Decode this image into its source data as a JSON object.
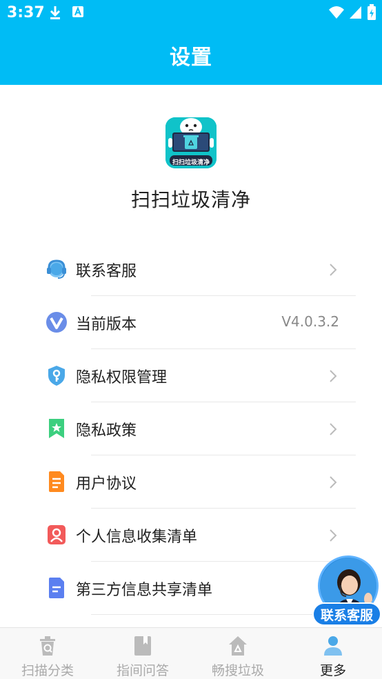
{
  "status_bar": {
    "time": "3:37"
  },
  "header": {
    "title": "设置"
  },
  "app": {
    "name": "扫扫垃圾清净",
    "logo_text": "扫扫垃圾清净"
  },
  "menu": {
    "items": [
      {
        "label": "联系客服",
        "icon": "headset-icon",
        "has_arrow": true
      },
      {
        "label": "当前版本",
        "icon": "version-icon",
        "value": "V4.0.3.2"
      },
      {
        "label": "隐私权限管理",
        "icon": "shield-key-icon",
        "has_arrow": true
      },
      {
        "label": "隐私政策",
        "icon": "bookmark-star-icon",
        "has_arrow": true
      },
      {
        "label": "用户协议",
        "icon": "document-icon",
        "has_arrow": true
      },
      {
        "label": "个人信息收集清单",
        "icon": "person-card-icon",
        "has_arrow": true
      },
      {
        "label": "第三方信息共享清单",
        "icon": "file-list-icon",
        "has_arrow": true
      }
    ]
  },
  "float_button": {
    "label": "联系客服"
  },
  "tabbar": {
    "tabs": [
      {
        "label": "扫描分类",
        "icon": "trash-scan-icon",
        "active": false
      },
      {
        "label": "指间问答",
        "icon": "book-icon",
        "active": false
      },
      {
        "label": "畅搜垃圾",
        "icon": "home-recycle-icon",
        "active": false
      },
      {
        "label": "更多",
        "icon": "person-icon",
        "active": true
      }
    ]
  },
  "colors": {
    "accent": "#00bcf5",
    "active_tab": "#4aa8e8"
  }
}
